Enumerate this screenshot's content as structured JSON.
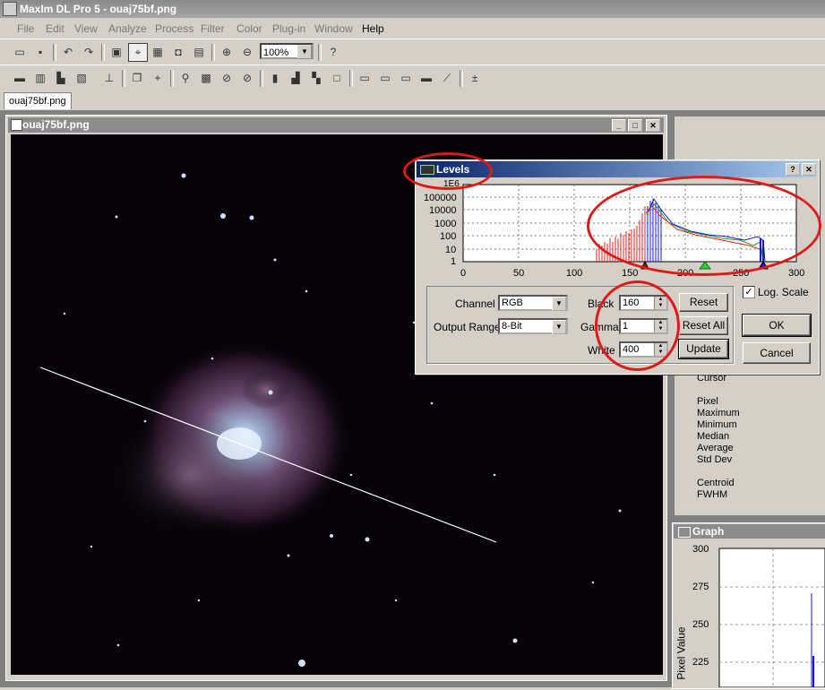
{
  "app": {
    "title": "MaxIm DL Pro 5 - ouaj75bf.png"
  },
  "menu": [
    "File",
    "Edit",
    "View",
    "Analyze",
    "Process",
    "Filter",
    "Color",
    "Plug-in",
    "Window",
    "Help"
  ],
  "toolbar": {
    "zoom_value": "100%"
  },
  "doc_tab": {
    "label": "ouaj75bf.png"
  },
  "image_window": {
    "title": "ouaj75bf.png"
  },
  "levels_dialog": {
    "title": "Levels",
    "histogram": {
      "y_tick_labels": [
        "1E6",
        "100000",
        "10000",
        "1000",
        "100",
        "10",
        "1"
      ],
      "x_tick_labels": [
        "0",
        "50",
        "100",
        "150",
        "200",
        "250",
        "300"
      ],
      "x_range": [
        0,
        300
      ]
    },
    "channel_label": "Channel",
    "channel_value": "RGB",
    "output_range_label": "Output Range",
    "output_range_value": "8-Bit",
    "black_label": "Black",
    "black_value": "160",
    "gamma_label": "Gamma",
    "gamma_value": "1",
    "white_label": "White",
    "white_value": "400",
    "reset_label": "Reset",
    "reset_all_label": "Reset All",
    "update_label": "Update",
    "log_scale_label": "Log. Scale",
    "log_scale_checked": true,
    "ok_label": "OK",
    "cancel_label": "Cancel"
  },
  "info_panel": {
    "labels": [
      "Cursor",
      "Pixel",
      "Maximum",
      "Minimum",
      "Median",
      "Average",
      "Std Dev",
      "Centroid",
      "FWHM"
    ]
  },
  "graph_window": {
    "title": "Graph",
    "y_axis_label": "Pixel Value",
    "y_tick_labels": [
      "300",
      "275",
      "250",
      "225"
    ]
  },
  "colors": {
    "annotation": "#e01818",
    "dialog_title": "#0a246a"
  }
}
